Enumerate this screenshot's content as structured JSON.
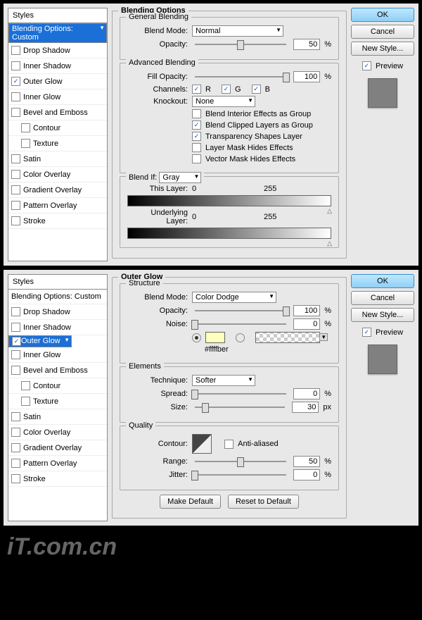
{
  "styles_header": "Styles",
  "top": {
    "selected": "Blending Options: Custom",
    "items": [
      "Drop Shadow",
      "Inner Shadow",
      "Outer Glow",
      "Inner Glow",
      "Bevel and Emboss",
      "Contour",
      "Texture",
      "Satin",
      "Color Overlay",
      "Gradient Overlay",
      "Pattern Overlay",
      "Stroke"
    ],
    "checked": [
      "Outer Glow"
    ]
  },
  "bottom": {
    "selected": "Outer Glow",
    "header": "Blending Options: Custom",
    "items": [
      "Drop Shadow",
      "Inner Shadow",
      "Outer Glow",
      "Inner Glow",
      "Bevel and Emboss",
      "Contour",
      "Texture",
      "Satin",
      "Color Overlay",
      "Gradient Overlay",
      "Pattern Overlay",
      "Stroke"
    ],
    "checked": [
      "Outer Glow"
    ]
  },
  "btns": {
    "ok": "OK",
    "cancel": "Cancel",
    "newstyle": "New Style...",
    "preview": "Preview"
  },
  "blending": {
    "title": "Blending Options",
    "general": {
      "title": "General Blending",
      "blend_mode_l": "Blend Mode:",
      "blend_mode": "Normal",
      "opacity_l": "Opacity:",
      "opacity": "50",
      "pct": "%"
    },
    "advanced": {
      "title": "Advanced Blending",
      "fill_l": "Fill Opacity:",
      "fill": "100",
      "channels_l": "Channels:",
      "r": "R",
      "g": "G",
      "b": "B",
      "knockout_l": "Knockout:",
      "knockout": "None",
      "c1": "Blend Interior Effects as Group",
      "c2": "Blend Clipped Layers as Group",
      "c3": "Transparency Shapes Layer",
      "c4": "Layer Mask Hides Effects",
      "c5": "Vector Mask Hides Effects"
    },
    "blendif": {
      "title": "Blend If:",
      "mode": "Gray",
      "this_l": "This Layer:",
      "v0": "0",
      "v1": "255",
      "under_l": "Underlying Layer:"
    }
  },
  "glow": {
    "title": "Outer Glow",
    "structure": {
      "title": "Structure",
      "blend_mode_l": "Blend Mode:",
      "blend_mode": "Color Dodge",
      "opacity_l": "Opacity:",
      "opacity": "100",
      "noise_l": "Noise:",
      "noise": "0",
      "color_hex": "#ffffber"
    },
    "elements": {
      "title": "Elements",
      "technique_l": "Technique:",
      "technique": "Softer",
      "spread_l": "Spread:",
      "spread": "0",
      "size_l": "Size:",
      "size": "30",
      "px": "px"
    },
    "quality": {
      "title": "Quality",
      "contour_l": "Contour:",
      "aa": "Anti-aliased",
      "range_l": "Range:",
      "range": "50",
      "jitter_l": "Jitter:",
      "jitter": "0"
    },
    "make_default": "Make Default",
    "reset_default": "Reset to Default"
  },
  "pct": "%",
  "logo": "iT.com.cn"
}
